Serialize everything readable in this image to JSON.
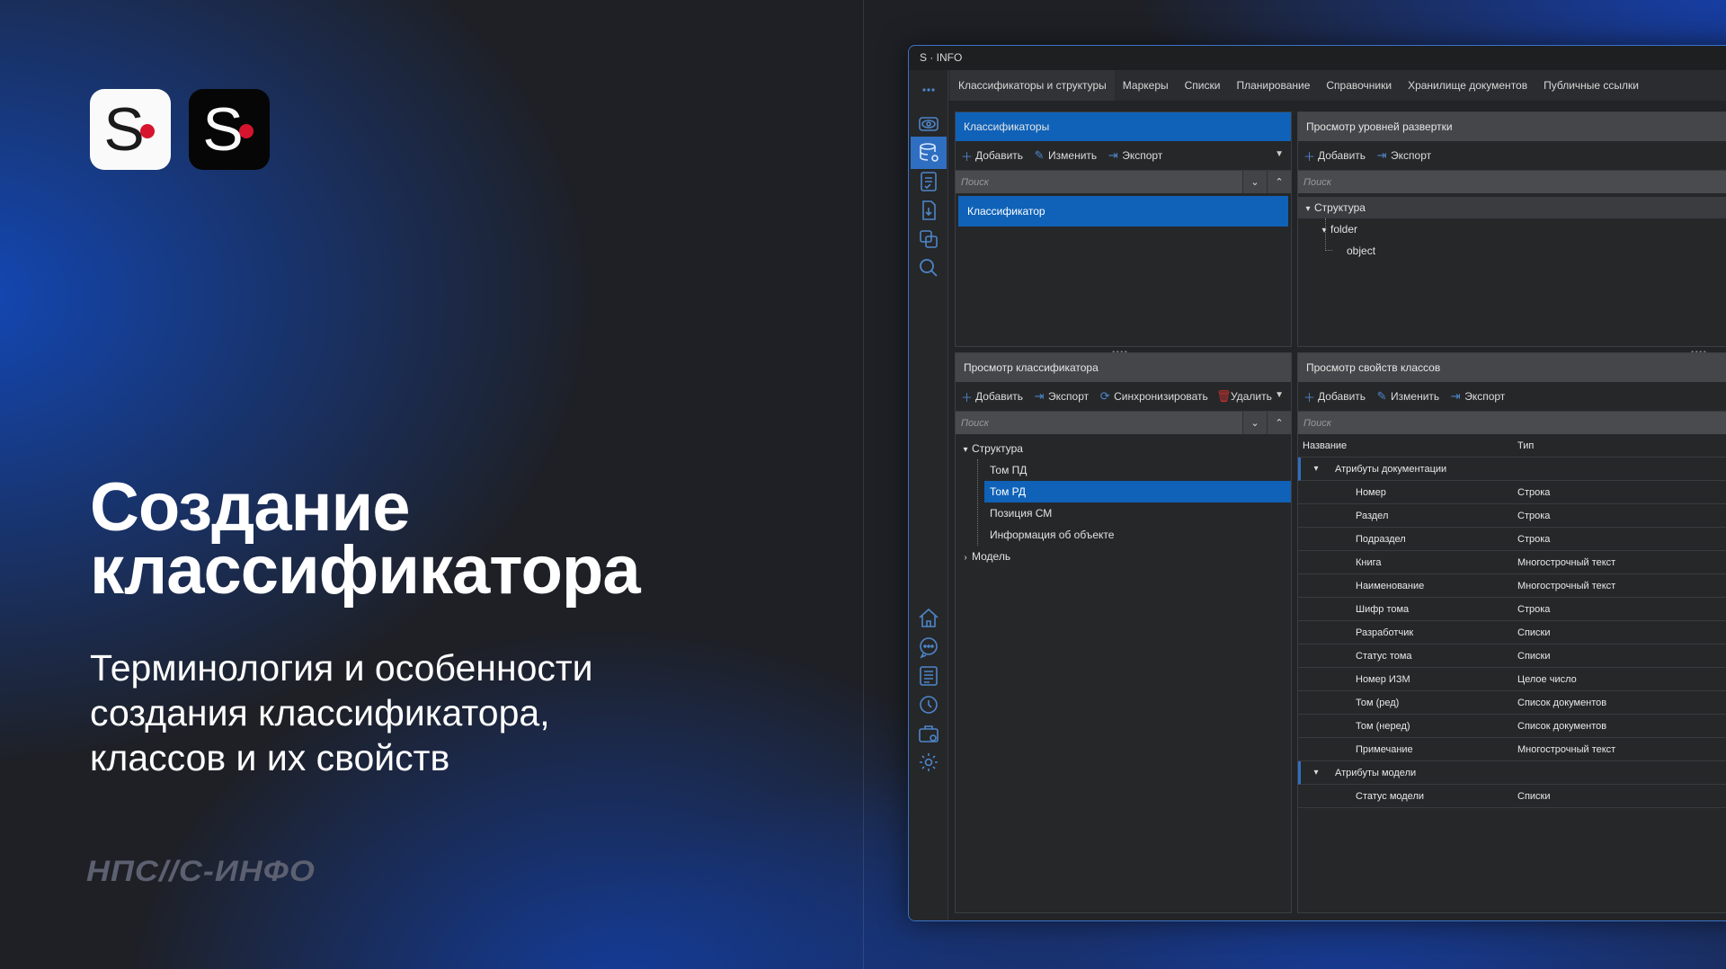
{
  "slide": {
    "title_line1": "Создание",
    "title_line2": "классификатора",
    "subtitle_line1": "Терминология и особенности",
    "subtitle_line2": "создания классификатора,",
    "subtitle_line3": "классов и их свойств",
    "brand": "НПС//С-ИНФО",
    "logo_letter": "S",
    "accent_red": "#d7142d",
    "accent_blue": "#0f62b8"
  },
  "app": {
    "title": "S · INFO",
    "sidebar_icons": [
      "more-icon",
      "eye-icon",
      "database-icon",
      "document-check-icon",
      "document-download-icon",
      "copy-icon",
      "search-icon",
      "home-icon",
      "chat-icon",
      "list-icon",
      "history-icon",
      "briefcase-icon",
      "settings-icon"
    ],
    "tabs": [
      "Классификаторы и структуры",
      "Маркеры",
      "Списки",
      "Планирование",
      "Справочники",
      "Хранилище документов",
      "Публичные ссылки"
    ],
    "classifiers": {
      "header": "Классификаторы",
      "add": "Добавить",
      "edit": "Изменить",
      "export": "Экспорт",
      "search_placeholder": "Поиск",
      "items": [
        "Классификатор"
      ]
    },
    "levels": {
      "header": "Просмотр уровней развертки",
      "add": "Добавить",
      "export": "Экспорт",
      "search_placeholder": "Поиск",
      "tree": [
        "Структура",
        "folder",
        "object"
      ]
    },
    "classifier_view": {
      "header": "Просмотр классификатора",
      "add": "Добавить",
      "export": "Экспорт",
      "sync": "Синхронизировать",
      "delete": "Удалить",
      "search_placeholder": "Поиск",
      "tree_root": "Структура",
      "tree_children": [
        "Том ПД",
        "Том РД",
        "Позиция СМ",
        "Информация об объекте"
      ],
      "tree_model": "Модель"
    },
    "class_props": {
      "header": "Просмотр свойств классов",
      "add": "Добавить",
      "edit": "Изменить",
      "export": "Экспорт",
      "search_placeholder": "Поиск",
      "col_name": "Название",
      "col_type": "Тип",
      "group1": "Атрибуты документации",
      "rows1": [
        {
          "name": "Номер",
          "type": "Строка"
        },
        {
          "name": "Раздел",
          "type": "Строка"
        },
        {
          "name": "Подраздел",
          "type": "Строка"
        },
        {
          "name": "Книга",
          "type": "Многострочный текст"
        },
        {
          "name": "Наименование",
          "type": "Многострочный текст"
        },
        {
          "name": "Шифр тома",
          "type": "Строка"
        },
        {
          "name": "Разработчик",
          "type": "Списки"
        },
        {
          "name": "Статус тома",
          "type": "Списки"
        },
        {
          "name": "Номер ИЗМ",
          "type": "Целое число"
        },
        {
          "name": "Том (ред)",
          "type": "Список документов"
        },
        {
          "name": "Том (неред)",
          "type": "Список документов"
        },
        {
          "name": "Примечание",
          "type": "Многострочный текст"
        }
      ],
      "group2": "Атрибуты модели",
      "rows2": [
        {
          "name": "Статус модели",
          "type": "Списки"
        }
      ]
    }
  }
}
